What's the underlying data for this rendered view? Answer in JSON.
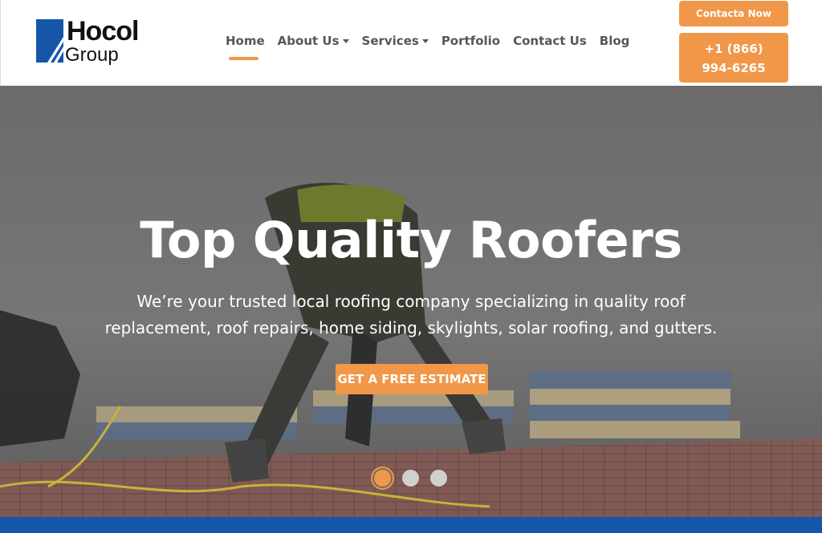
{
  "brand": {
    "line1": "Hocol",
    "line2": "Group",
    "accent": "#f0974a",
    "blue": "#1556a8"
  },
  "nav": {
    "items": [
      {
        "label": "Home",
        "active": true,
        "dropdown": false
      },
      {
        "label": "About Us",
        "active": false,
        "dropdown": true
      },
      {
        "label": "Services",
        "active": false,
        "dropdown": true
      },
      {
        "label": "Portfolio",
        "active": false,
        "dropdown": false
      },
      {
        "label": "Contact Us",
        "active": false,
        "dropdown": false
      },
      {
        "label": "Blog",
        "active": false,
        "dropdown": false
      }
    ]
  },
  "header": {
    "contact_label": "Contacta Now",
    "phone_label": "+1 (866) 994-6265"
  },
  "hero": {
    "title": "Top Quality Roofers",
    "subtitle": "We’re your trusted local roofing company specializing in quality roof replacement, roof repairs, home siding, skylights, solar roofing, and gutters.",
    "cta_label": "GET A FREE ESTIMATE",
    "slides": 3,
    "active_slide": 1
  }
}
